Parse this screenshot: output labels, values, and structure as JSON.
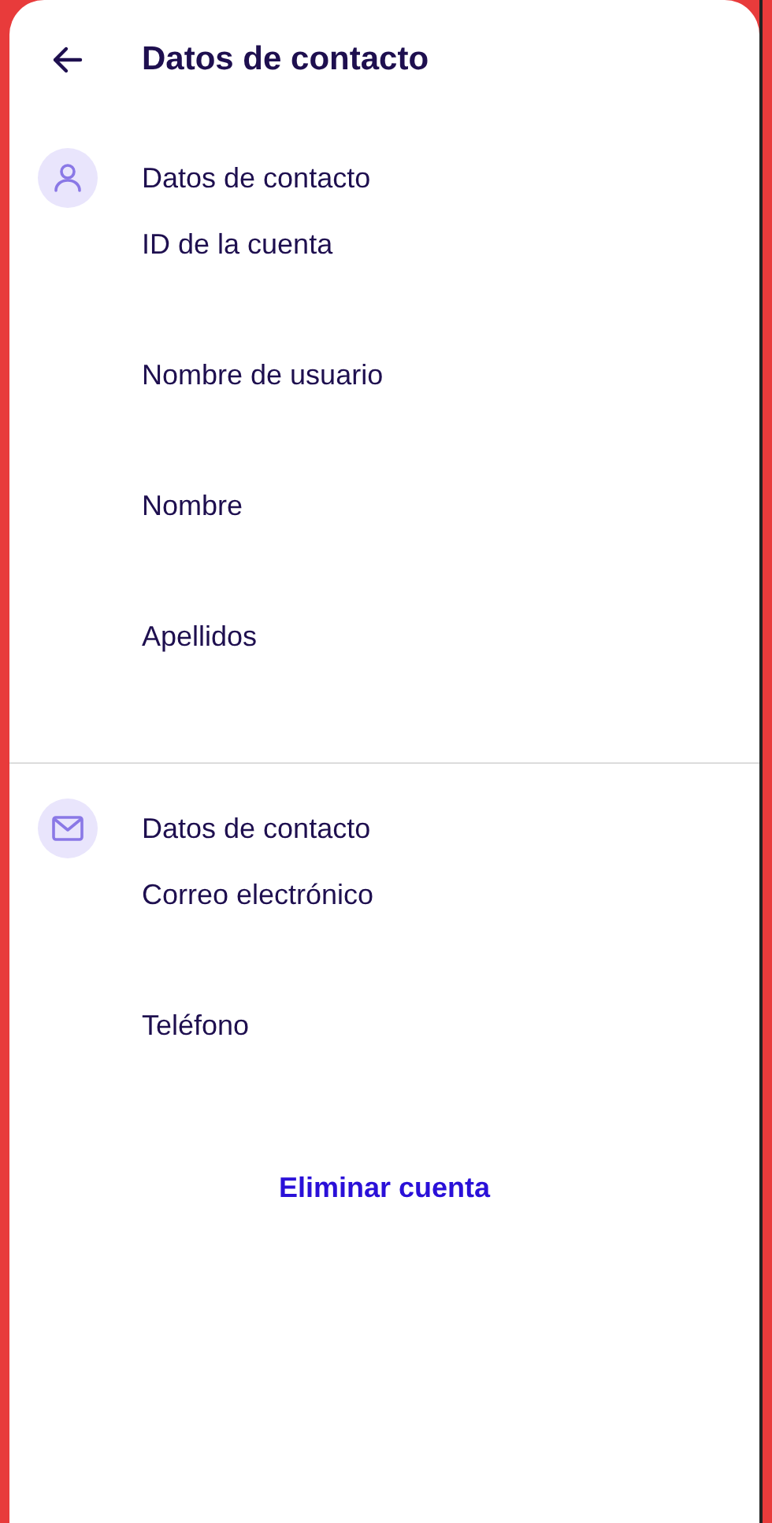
{
  "header": {
    "title": "Datos de contacto"
  },
  "sections": [
    {
      "kind": "person",
      "title": "Datos de contacto",
      "fields": [
        {
          "label": "ID de la cuenta"
        },
        {
          "label": "Nombre de usuario"
        },
        {
          "label": "Nombre"
        },
        {
          "label": "Apellidos"
        }
      ]
    },
    {
      "kind": "mail",
      "title": "Datos de contacto",
      "fields": [
        {
          "label": "Correo electrónico"
        },
        {
          "label": "Teléfono"
        }
      ]
    }
  ],
  "delete_button": "Eliminar cuenta"
}
